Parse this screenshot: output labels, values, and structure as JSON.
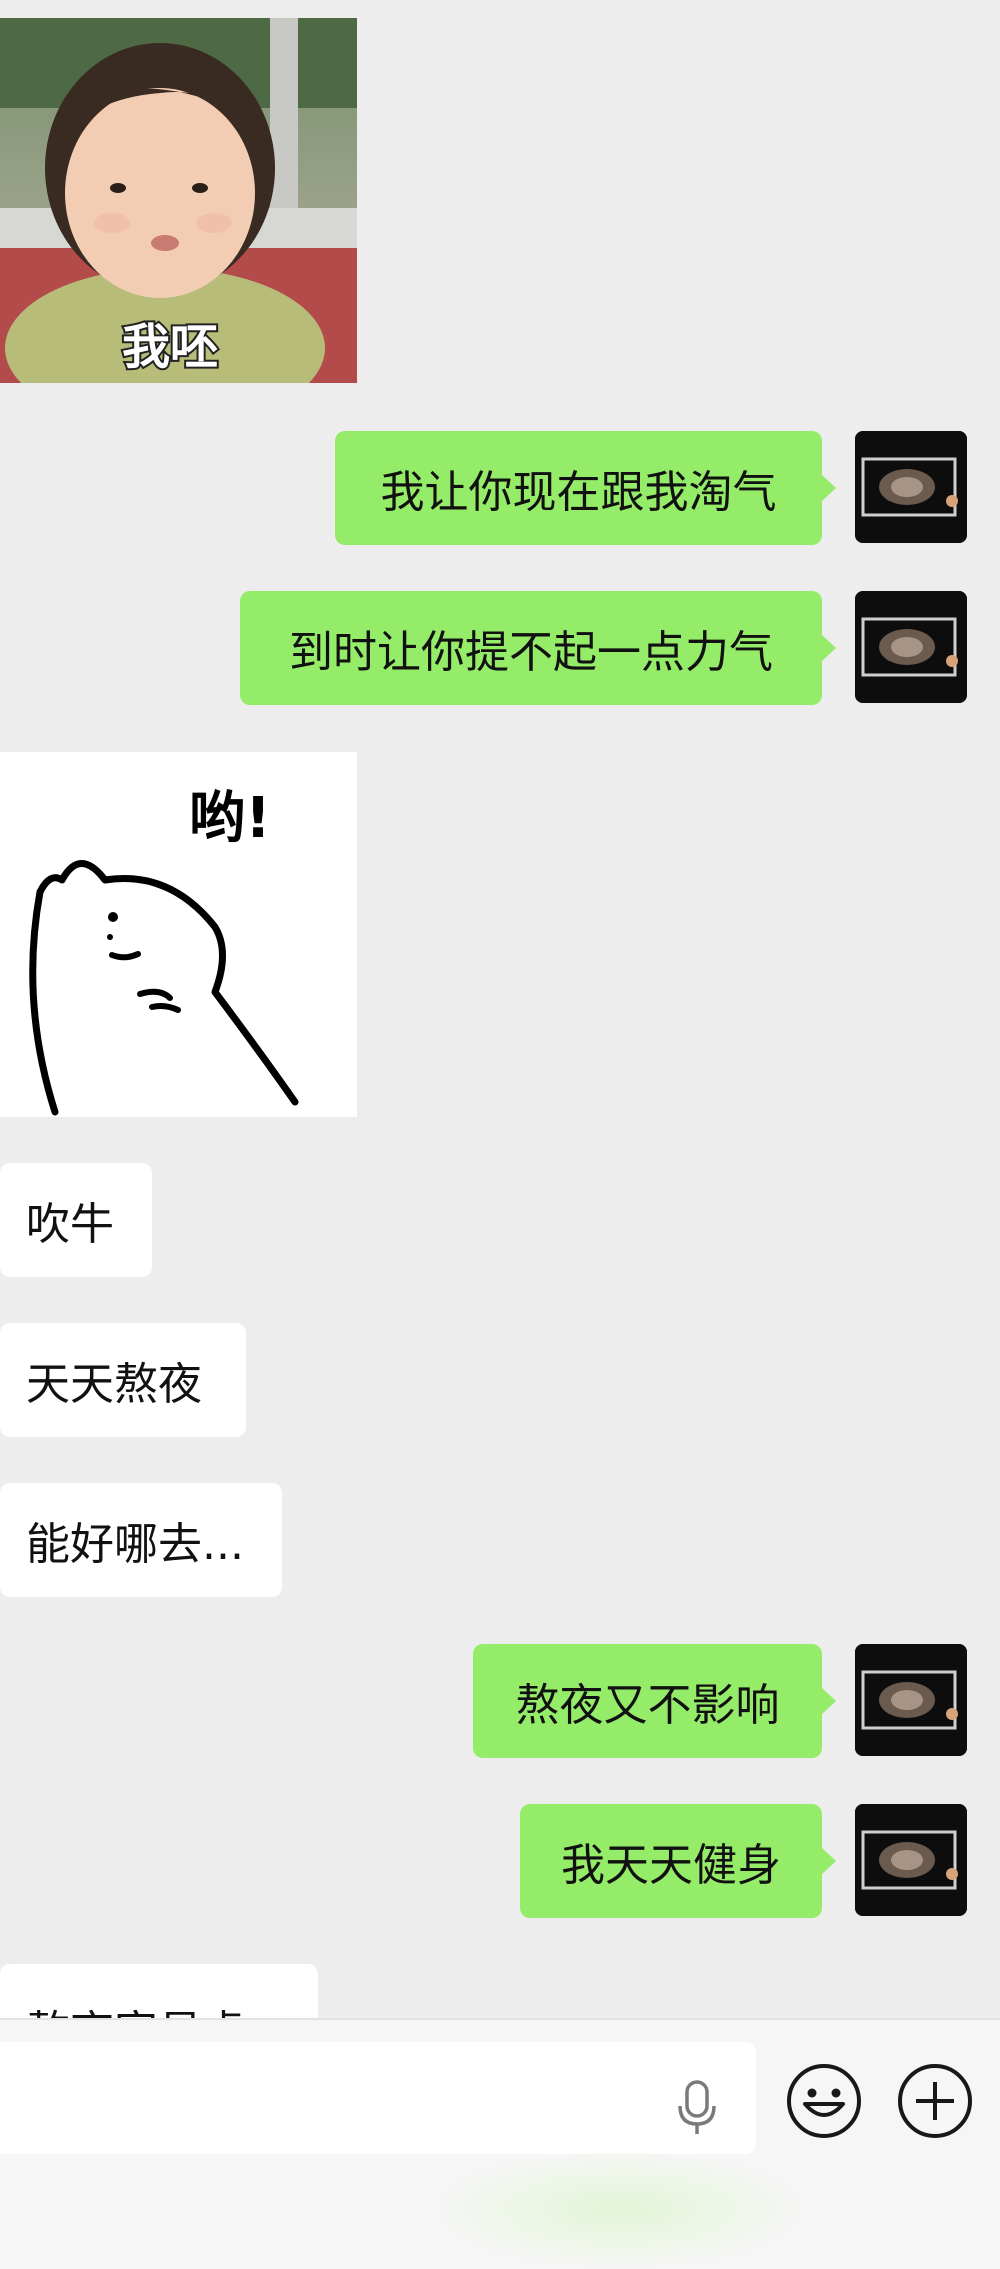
{
  "colors": {
    "outgoing_bubble": "#95ec69",
    "incoming_bubble": "#ffffff",
    "background": "#ededed"
  },
  "messages": [
    {
      "side": "in",
      "kind": "sticker",
      "caption": "我呸"
    },
    {
      "side": "out",
      "kind": "text",
      "text": "我让你现在跟我淘气"
    },
    {
      "side": "out",
      "kind": "text",
      "text": "到时让你提不起一点力气"
    },
    {
      "side": "in",
      "kind": "sticker",
      "caption": "哟!"
    },
    {
      "side": "in",
      "kind": "text",
      "text": "吹牛"
    },
    {
      "side": "in",
      "kind": "text",
      "text": "天天熬夜"
    },
    {
      "side": "in",
      "kind": "text",
      "text": "能好哪去..."
    },
    {
      "side": "out",
      "kind": "text",
      "text": "熬夜又不影响"
    },
    {
      "side": "out",
      "kind": "text",
      "text": "我天天健身"
    },
    {
      "side": "in",
      "kind": "text",
      "text": "熬夜容易虚"
    }
  ],
  "input_bar": {
    "mic_icon": "microphone-icon",
    "emoji_icon": "smiley-face-icon",
    "plus_icon": "plus-circle-icon"
  }
}
